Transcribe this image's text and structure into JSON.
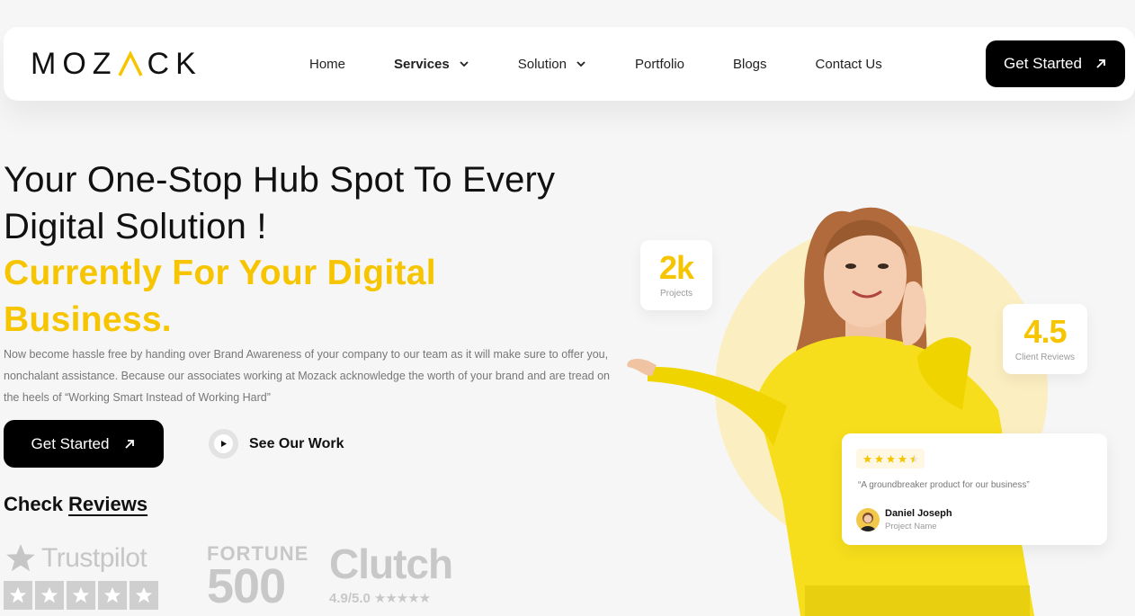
{
  "nav": {
    "logo": "MOZACK",
    "items": [
      {
        "label": "Home",
        "dropdown": false,
        "active": false
      },
      {
        "label": "Services",
        "dropdown": true,
        "active": true
      },
      {
        "label": "Solution",
        "dropdown": true,
        "active": false
      },
      {
        "label": "Portfolio",
        "dropdown": false,
        "active": false
      },
      {
        "label": "Blogs",
        "dropdown": false,
        "active": false
      },
      {
        "label": "Contact Us",
        "dropdown": false,
        "active": false
      }
    ],
    "cta_label": "Get Started"
  },
  "hero": {
    "headline_line1": "Your One-Stop Hub Spot To Every",
    "headline_line2": "Digital Solution !",
    "highlight_line1": "Currently For Your Digital",
    "highlight_line2": "Business.",
    "description": "Now become hassle free by handing over Brand Awareness of your company to our team as it will make sure to offer you, nonchalant assistance. Because our associates working at Mozack acknowledge the worth of your brand and are tread on the heels of “Working Smart Instead of Working Hard”",
    "primary_button": "Get Started",
    "secondary_button": "See Our Work",
    "reviews_prefix": "Check",
    "reviews_link": "Reviews"
  },
  "logos": {
    "trustpilot": "Trustpilot",
    "fortune_top": "FORTUNE",
    "fortune_bottom": "500",
    "clutch": "Clutch",
    "clutch_rating": "4.9/5.0"
  },
  "stats": {
    "projects_value": "2k",
    "projects_label": "Projects",
    "rating_value": "4.5",
    "rating_label": "Client Reviews"
  },
  "review": {
    "stars": 4.5,
    "quote": "“A groundbreaker product for our business”",
    "name": "Daniel Joseph",
    "role": "Project Name"
  },
  "colors": {
    "accent": "#f7c500",
    "dark": "#000000",
    "background": "#f6f6f6"
  }
}
